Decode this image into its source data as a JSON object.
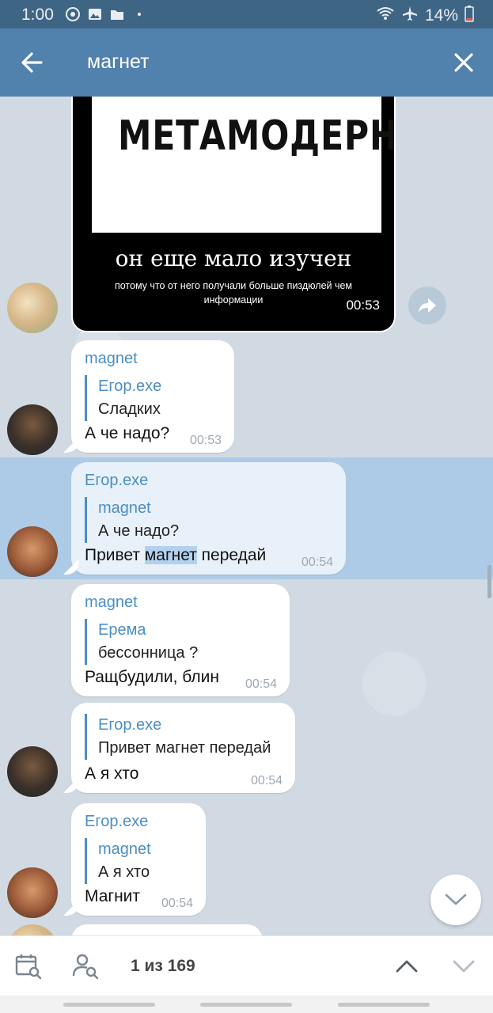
{
  "status": {
    "time": "1:00",
    "battery": "14%"
  },
  "header": {
    "search_query": "магнет"
  },
  "photo_message": {
    "poster_title": "МЕТАМОДЕРН",
    "caption_main": "он еще мало изучен",
    "caption_sub": "потому что от него получали больше пиздюлей чем информации",
    "time": "00:53"
  },
  "messages": [
    {
      "sender": "magnet",
      "reply_name": "Егор.exe",
      "reply_text": "Сладких",
      "text": "А че надо?",
      "time": "00:53"
    },
    {
      "sender": "Егор.exe",
      "reply_name": "magnet",
      "reply_text": "А че надо?",
      "text_before": "Привет ",
      "text_highlight": "магнет",
      "text_after": " передай",
      "time": "00:54"
    },
    {
      "sender": "magnet",
      "reply_name": "Ерема",
      "reply_text": "бессонница ?",
      "text": "Ращбудили, блин",
      "time": "00:54"
    },
    {
      "reply_name": "Егор.exe",
      "reply_text": "Привет магнет передай",
      "text": "А я хто",
      "time": "00:54"
    },
    {
      "sender": "Егор.exe",
      "reply_name": "magnet",
      "reply_text": "А я хто",
      "text": "Магнит",
      "time": "00:54"
    }
  ],
  "search_bar": {
    "counter": "1 из 169"
  }
}
